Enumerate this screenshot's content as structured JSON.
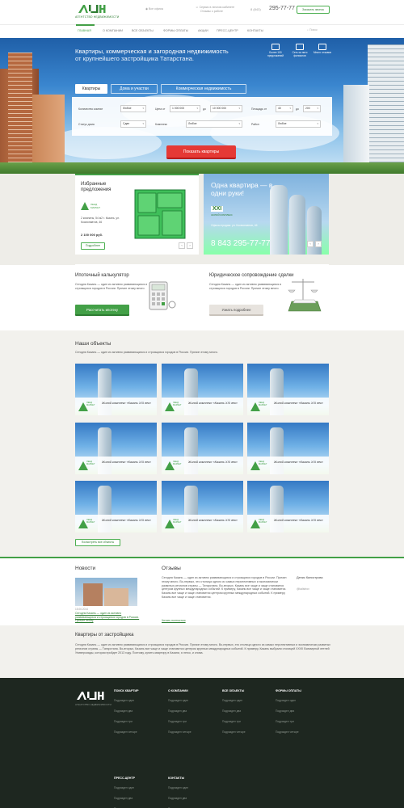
{
  "header": {
    "logo_text": "АН",
    "logo_sub": "АГЕНТСТВО НЕДВИЖИМОСТИ",
    "address_label": "Все офисы",
    "service_label": "Сервис в личном кабинете",
    "service_sub": "Отзывы о работе",
    "phone_prefix": "8 (843)",
    "phone": "295-77-77",
    "callback_label": "Заказать звонок"
  },
  "nav": {
    "items": [
      "ГЛАВНАЯ",
      "О КОМПАНИИ",
      "ВСЕ ОБЪЕКТЫ",
      "ФОРМЫ ОПЛАТЫ",
      "АКЦИИ",
      "ПРЕСС-ЦЕНТР",
      "КОНТАКТЫ"
    ],
    "search_placeholder": "Поиск"
  },
  "hero": {
    "title_line1": "Квартиры, коммерческая и загородная недвижимость",
    "title_line2": "от крупнейшего застройщика Татарстана.",
    "features": [
      {
        "label": "Более 100 предложений",
        "icon": "building-icon"
      },
      {
        "label": "Сеть из пяти филиалов",
        "icon": "network-icon"
      },
      {
        "label": "Много отзывов",
        "icon": "chat-icon"
      }
    ],
    "tabs": [
      "Квартиры",
      "Дома и участки",
      "Коммерческая недвижимость"
    ],
    "active_tab": 0,
    "form": {
      "rooms_label": "Количество комнат",
      "rooms_value": "Любое",
      "price_label": "Цена от",
      "price_from": "1 000 000",
      "price_to_label": "до",
      "price_to": "10 000 000",
      "area_label": "Площадь от",
      "area_from": "40",
      "area_to_label": "до",
      "area_to": "200",
      "status_label": "Статус дома",
      "status_value": "Сдан",
      "complex_label": "Комплекс",
      "complex_value": "Любое",
      "district_label": "Район",
      "district_value": "Любое"
    },
    "show_button": "Показать квартиры"
  },
  "favorites": {
    "title": "Избранные предложения",
    "brand": "ЛЕНД МАРКЕТ",
    "desc": "2 комнаты, 54 м2 г. Казань, ул. Космонавтов, 46",
    "price": "2 100 000 руб.",
    "more": "Подробнее"
  },
  "promo": {
    "title": "Одна квартира — в одни руки!",
    "brand": "XXI",
    "brand_sub": "ЖИЛОЙ КОМПЛЕКС",
    "text": "Офисы продаж: ул. Космонавтов, 46",
    "phone": "8 843 295-77-77"
  },
  "services": {
    "calc_title": "Ипотечный калькулятор",
    "calc_text": "Сегодня Казань — один из активно развивающихся и строящихся городов в России. Причин этому много.",
    "calc_button": "Рассчитать ипотеку",
    "legal_title": "Юридическое сопровождение сделки",
    "legal_text": "Сегодня Казань — один из активно развивающихся и строящихся городов в России. Причин этому много.",
    "legal_button": "Узнать подробнее"
  },
  "objects": {
    "title": "Наши объекты",
    "intro": "Сегодня Казань — один из активно развивающихся и строящихся городов в России. Причин этому много.",
    "items": [
      {
        "title": "Жилой комплекс «Казань XXI век»"
      },
      {
        "title": "Жилой комплекс «Казань XXI век»"
      },
      {
        "title": "Жилой комплекс «Казань XXI век»"
      },
      {
        "title": "Жилой комплекс «Казань XXI век»"
      },
      {
        "title": "Жилой комплекс «Казань XXI век»"
      },
      {
        "title": "Жилой комплекс «Казань XXI век»"
      },
      {
        "title": "Жилой комплекс «Казань XXI век»"
      },
      {
        "title": "Жилой комплекс «Казань XXI век»"
      },
      {
        "title": "Жилой комплекс «Казань XXI век»"
      }
    ],
    "brand": "ЛЕНД МАРКЕТ",
    "show_all": "Посмотреть все объекты"
  },
  "news": {
    "title": "Новости",
    "date": "15.06.2014",
    "link": "Сегодня Казань — один из активно развивающихся и строящихся городов в России. Причин этому",
    "all": "Смотреть все новости"
  },
  "reviews": {
    "title": "Отзывы",
    "text": "Сегодня Казань — один из активно развивающихся и строящихся городов в России. Причин этому много. Во-первых, это столица одного из самых перспективных и экономически развитых регионов страны — Татарстана. Во-вторых, Казань все чаще и чаще становится центром крупных международных событий. К примеру, Казань все чаще и чаще становится. Казань все чаще и чаще становится центром крупных международных событий. К примеру, Казань все чаще и чаще становится.",
    "read_more": "Читать полностью",
    "author": "Денис Килистрова",
    "author_sub": "@kalistrov",
    "all": "Смотреть все отзывы"
  },
  "about": {
    "title": "Квартиры от застройщика",
    "text": "Сегодня Казань — один из активно развивающихся и строящихся городов в России. Причин этому много. Во-первых, это столица одного из самых перспективных и экономически развитых регионов страны — Татарстана. Во-вторых, Казань все чаще и чаще становится центром крупных международных событий. К примеру, Казань выбрали столицей XXVII Всемирной летней Универсиады, которая пройдет 2013 году. Поэтому, купить квартиру в Казани, я легко, и снова."
  },
  "footer": {
    "logo_text": "АН",
    "logo_sub": "АГЕНТСТВО НЕДВИЖИМОСТИ",
    "columns": [
      {
        "title": "ПОИСК КВАРТИР",
        "items": [
          "Подраздел один",
          "Подраздел два",
          "Подраздел три",
          "Подраздел четыре"
        ]
      },
      {
        "title": "О КОМПАНИИ",
        "items": [
          "Подраздел один",
          "Подраздел два",
          "Подраздел три",
          "Подраздел четыре"
        ]
      },
      {
        "title": "ВСЕ ОБЪЕКТЫ",
        "items": [
          "Подраздел один",
          "Подраздел два",
          "Подраздел три",
          "Подраздел четыре"
        ]
      },
      {
        "title": "ФОРМЫ ОПЛАТЫ",
        "items": [
          "Подраздел один",
          "Подраздел два",
          "Подраздел три",
          "Подраздел четыре"
        ]
      },
      {
        "title": "ПРЕСС-ЦЕНТР",
        "items": [
          "Подраздел один",
          "Подраздел два",
          "Подраздел три",
          "Подраздел четыре"
        ]
      },
      {
        "title": "КОНТАКТЫ",
        "items": [
          "Подраздел один",
          "Подраздел два",
          "Подраздел три",
          "Подраздел четыре"
        ]
      }
    ]
  },
  "colors": {
    "accent": "#43a047",
    "cta": "#e53935",
    "footer": "#1e2720"
  }
}
